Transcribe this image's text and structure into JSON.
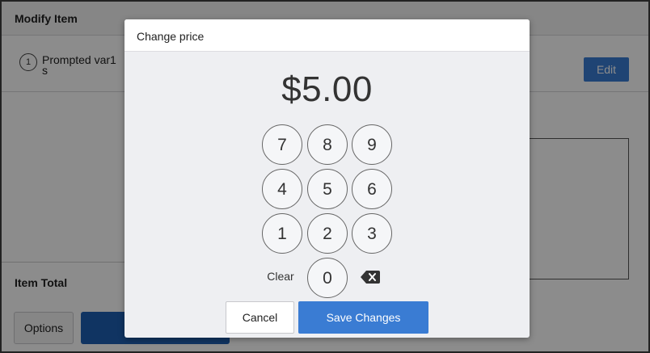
{
  "background": {
    "title": "Modify Item",
    "item": {
      "number": "1",
      "name": "Prompted var1 s"
    },
    "edit_label": "Edit",
    "item_total_label": "Item Total",
    "options_label": "Options"
  },
  "dialog": {
    "title": "Change price",
    "price": "$5.00",
    "keys": [
      "7",
      "8",
      "9",
      "4",
      "5",
      "6",
      "1",
      "2",
      "3",
      "0"
    ],
    "clear_label": "Clear",
    "backspace_icon": "backspace-icon",
    "cancel_label": "Cancel",
    "save_label": "Save Changes"
  },
  "colors": {
    "primary": "#3a7cd3",
    "overlay": "#000000"
  }
}
